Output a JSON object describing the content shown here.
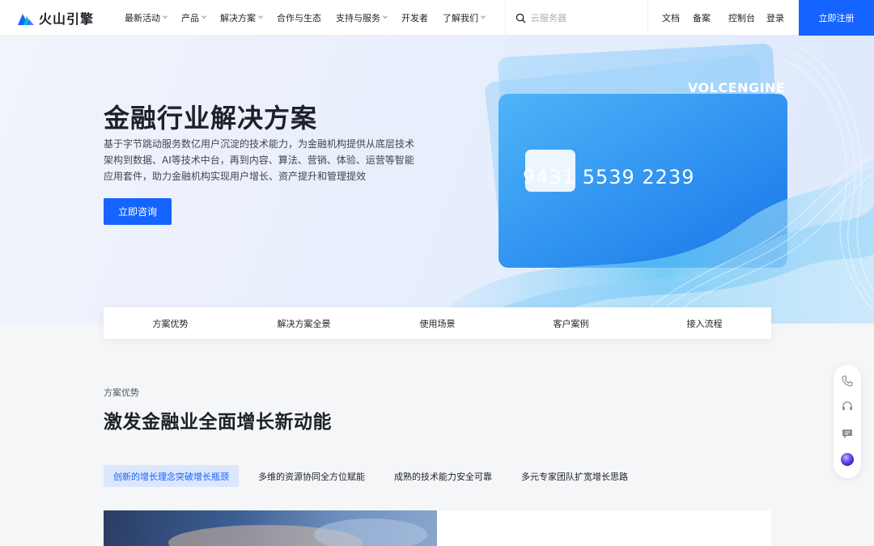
{
  "header": {
    "logo_text": "火山引擎",
    "nav": [
      {
        "label": "最新活动",
        "dropdown": true
      },
      {
        "label": "产品",
        "dropdown": true
      },
      {
        "label": "解决方案",
        "dropdown": true
      },
      {
        "label": "合作与生态",
        "dropdown": false
      },
      {
        "label": "支持与服务",
        "dropdown": true
      },
      {
        "label": "开发者",
        "dropdown": false
      },
      {
        "label": "了解我们",
        "dropdown": true
      }
    ],
    "search_placeholder": "云服务器",
    "links": [
      "文档",
      "备案",
      "控制台",
      "登录"
    ],
    "register_label": "立即注册"
  },
  "hero": {
    "title": "金融行业解决方案",
    "description": "基于字节跳动服务数亿用户沉淀的技术能力，为金融机构提供从底层技术架构到数据、AI等技术中台，再到内容、算法、营销、体验、运营等智能应用套件，助力金融机构实现用户增长、资产提升和管理提效",
    "cta_label": "立即咨询",
    "card_brand": "VOLCENGINE",
    "card_number": "9431  5539  2239"
  },
  "tabs": [
    "方案优势",
    "解决方案全景",
    "使用场景",
    "客户案例",
    "接入流程"
  ],
  "section": {
    "label": "方案优势",
    "title": "激发金融业全面增长新动能",
    "subtabs": [
      {
        "label": "创新的增长理念突破增长瓶颈",
        "active": true
      },
      {
        "label": "多维的资源协同全方位赋能",
        "active": false
      },
      {
        "label": "成熟的技术能力安全可靠",
        "active": false
      },
      {
        "label": "多元专家团队扩宽增长思路",
        "active": false
      }
    ]
  },
  "floating_bar": {
    "icons": [
      "phone-icon",
      "headset-icon",
      "chat-icon",
      "assistant-orb-icon"
    ]
  },
  "colors": {
    "primary": "#1664ff",
    "active_tab_bg": "#dce7fd"
  }
}
